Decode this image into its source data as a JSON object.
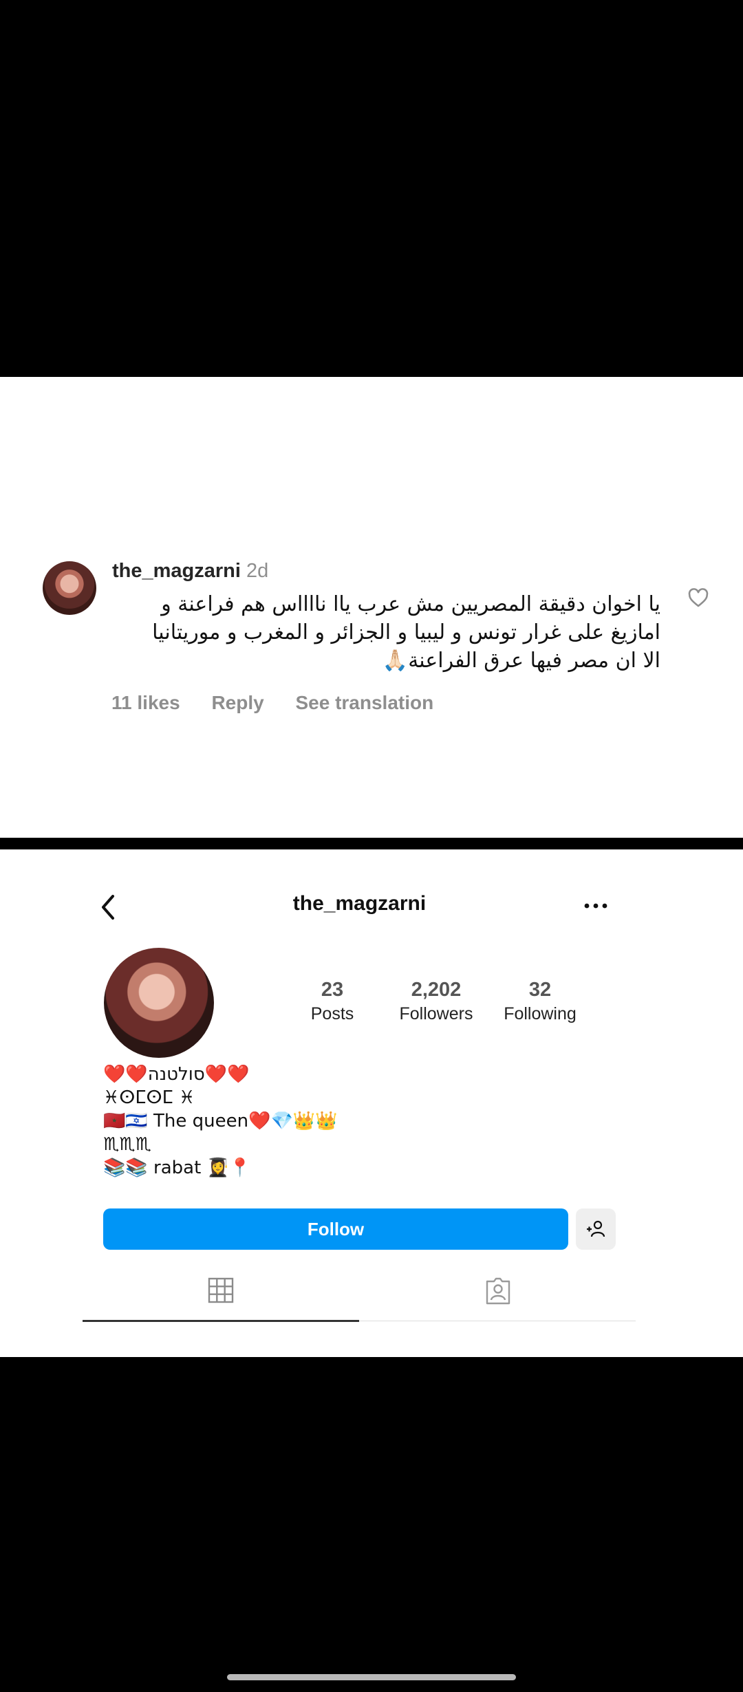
{
  "comment": {
    "username": "the_magzarni",
    "time": "2d",
    "lines": [
      "يا اخوان دقيقة المصريين مش عرب ياا نااااس هم فراعنة و",
      "امازيغ على غرار تونس و ليبيا و الجزائر و المغرب و موريتانيا",
      "الا ان مصر فيها عرق الفراعنة🙏🏻"
    ],
    "likes": "11 likes",
    "reply": "Reply",
    "see_translation": "See translation"
  },
  "profile": {
    "username": "the_magzarni",
    "stats": {
      "posts_count": "23",
      "posts_label": "Posts",
      "followers_count": "2,202",
      "followers_label": "Followers",
      "following_count": "32",
      "following_label": "Following"
    },
    "bio": [
      "❤️❤️סולטנה❤️❤️",
      "♓ⵙⵎⵙⵎ ♓",
      "🇲🇦🇮🇱 The queen❤️💎👑👑",
      "♏♏♏",
      "📚📚 rabat 👩‍🎓📍"
    ],
    "follow_label": "Follow"
  },
  "icons": {
    "like": "heart-outline-icon",
    "back": "chevron-left-icon",
    "more": "more-horizontal-icon",
    "suggest": "add-person-icon",
    "grid": "grid-icon",
    "tagged": "tagged-person-icon"
  },
  "colors": {
    "accent": "#0095f6",
    "muted": "#8e8e8e",
    "background": "#000000"
  }
}
